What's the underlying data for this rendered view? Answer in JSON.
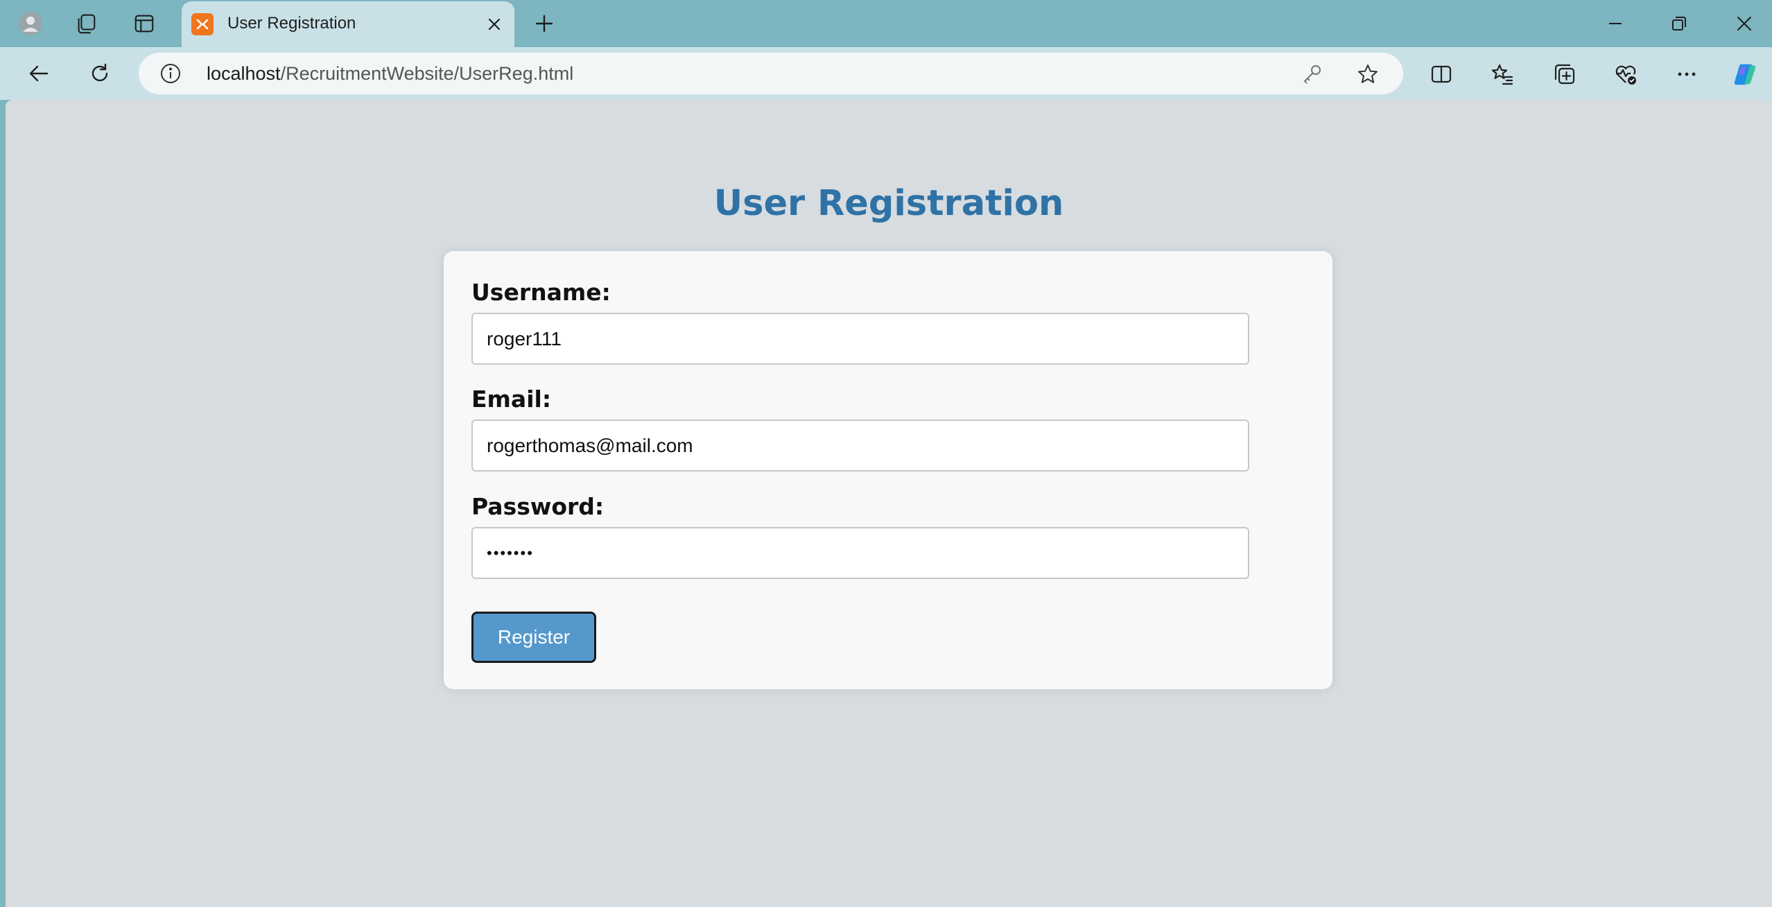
{
  "browser": {
    "tab": {
      "title": "User Registration"
    },
    "address_bar": {
      "url_host": "localhost",
      "url_path": "/RecruitmentWebsite/UserReg.html"
    },
    "icons": {
      "profile": "profile-avatar-icon",
      "workspaces": "workspaces-icon",
      "tab_actions": "tab-actions-icon",
      "favicon": "xampp-favicon",
      "close_tab": "close-icon",
      "new_tab": "plus-icon",
      "back": "back-arrow-icon",
      "refresh": "refresh-icon",
      "site_info": "info-icon",
      "password_key": "key-icon",
      "favorite": "star-icon",
      "split_screen": "split-screen-icon",
      "favorites": "favorites-list-icon",
      "collections": "collections-icon",
      "browser_essentials": "heart-pulse-icon",
      "more": "more-dots-icon",
      "copilot": "copilot-icon"
    },
    "colors": {
      "frame": "#7db5c0",
      "toolbar": "#c9e1e6",
      "accent": "#2e72a6"
    }
  },
  "page": {
    "heading": "User Registration",
    "form": {
      "username_label": "Username:",
      "username_value": "roger111",
      "email_label": "Email:",
      "email_value": "rogerthomas@mail.com",
      "password_label": "Password:",
      "password_value": "•••••••",
      "submit_label": "Register"
    }
  }
}
